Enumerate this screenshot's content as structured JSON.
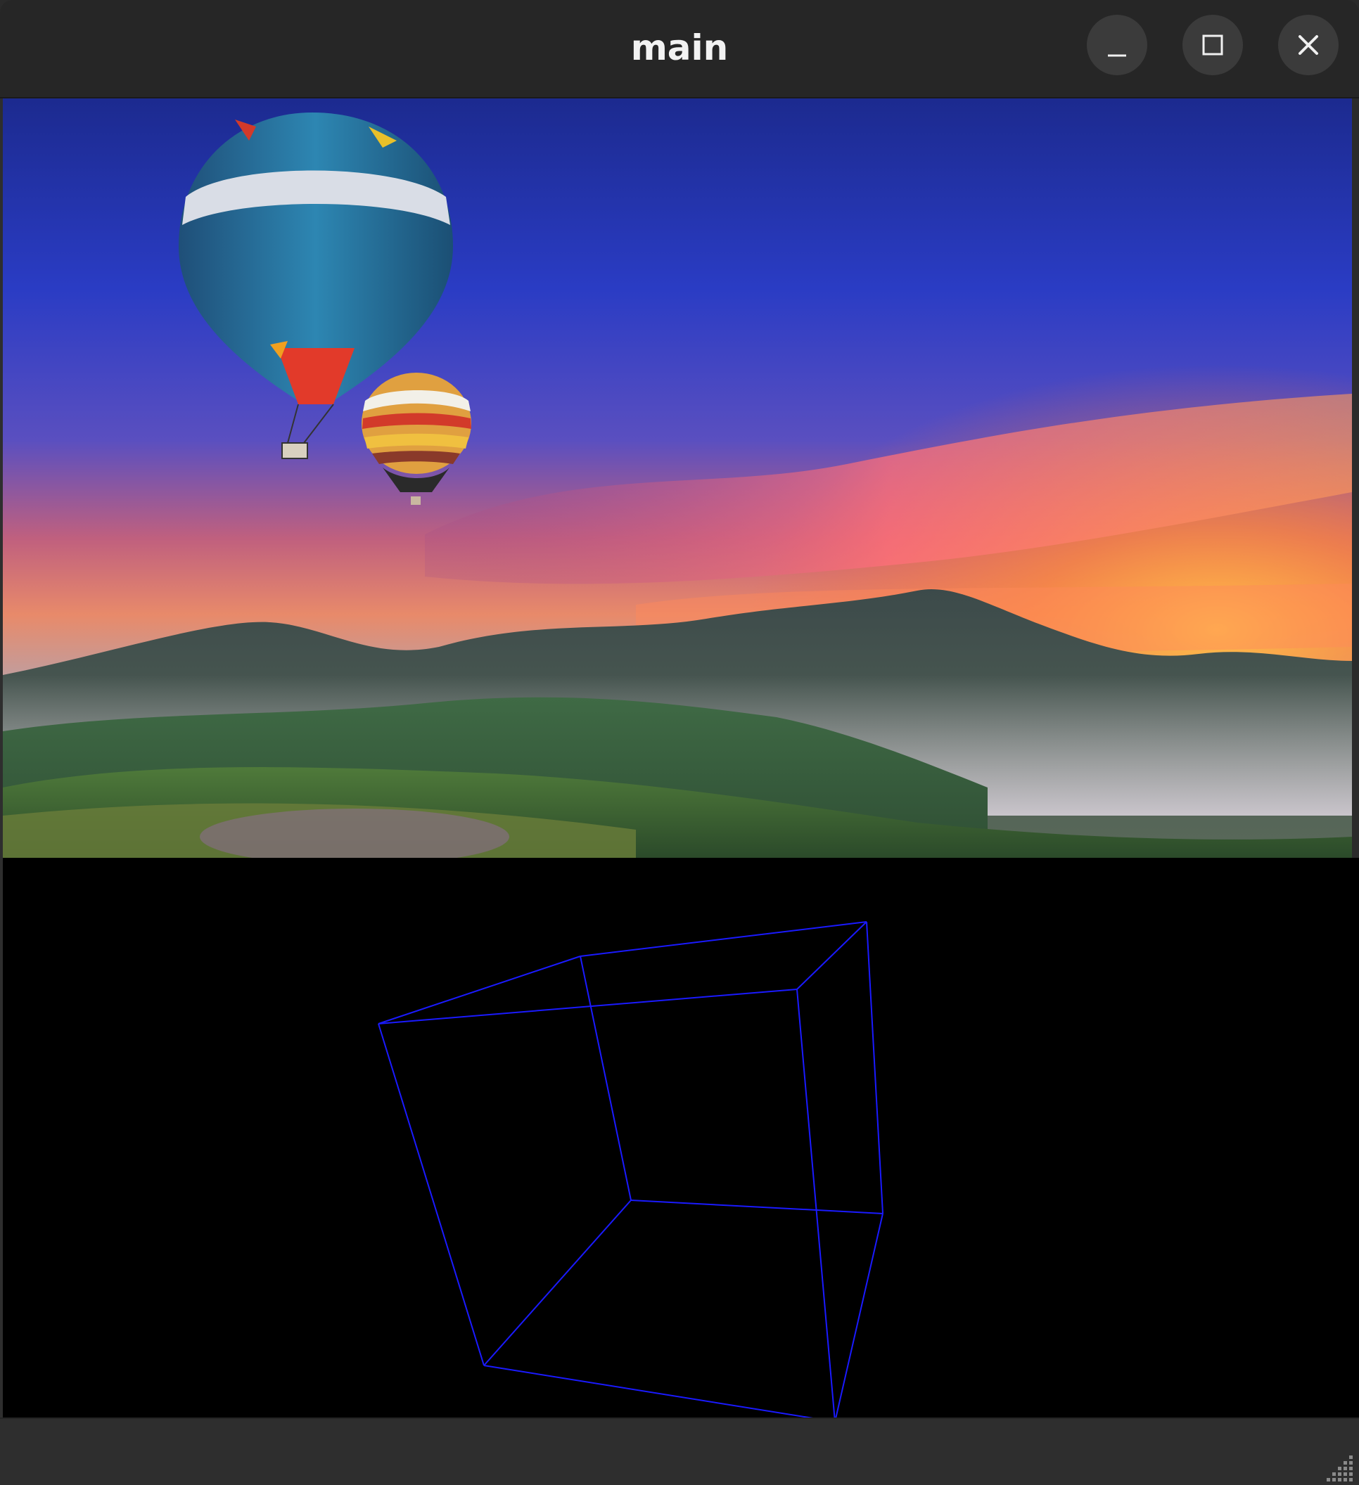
{
  "window": {
    "title": "main",
    "buttons": {
      "minimize": "minimize-icon",
      "maximize": "maximize-icon",
      "close": "close-icon"
    }
  },
  "scene": {
    "description_icon": "landscape-photo",
    "wireframe_color": "#1a1aff"
  },
  "colors": {
    "titlebar": "#262626",
    "title_text": "#f2f2f2",
    "canvas_bg": "#000000"
  }
}
